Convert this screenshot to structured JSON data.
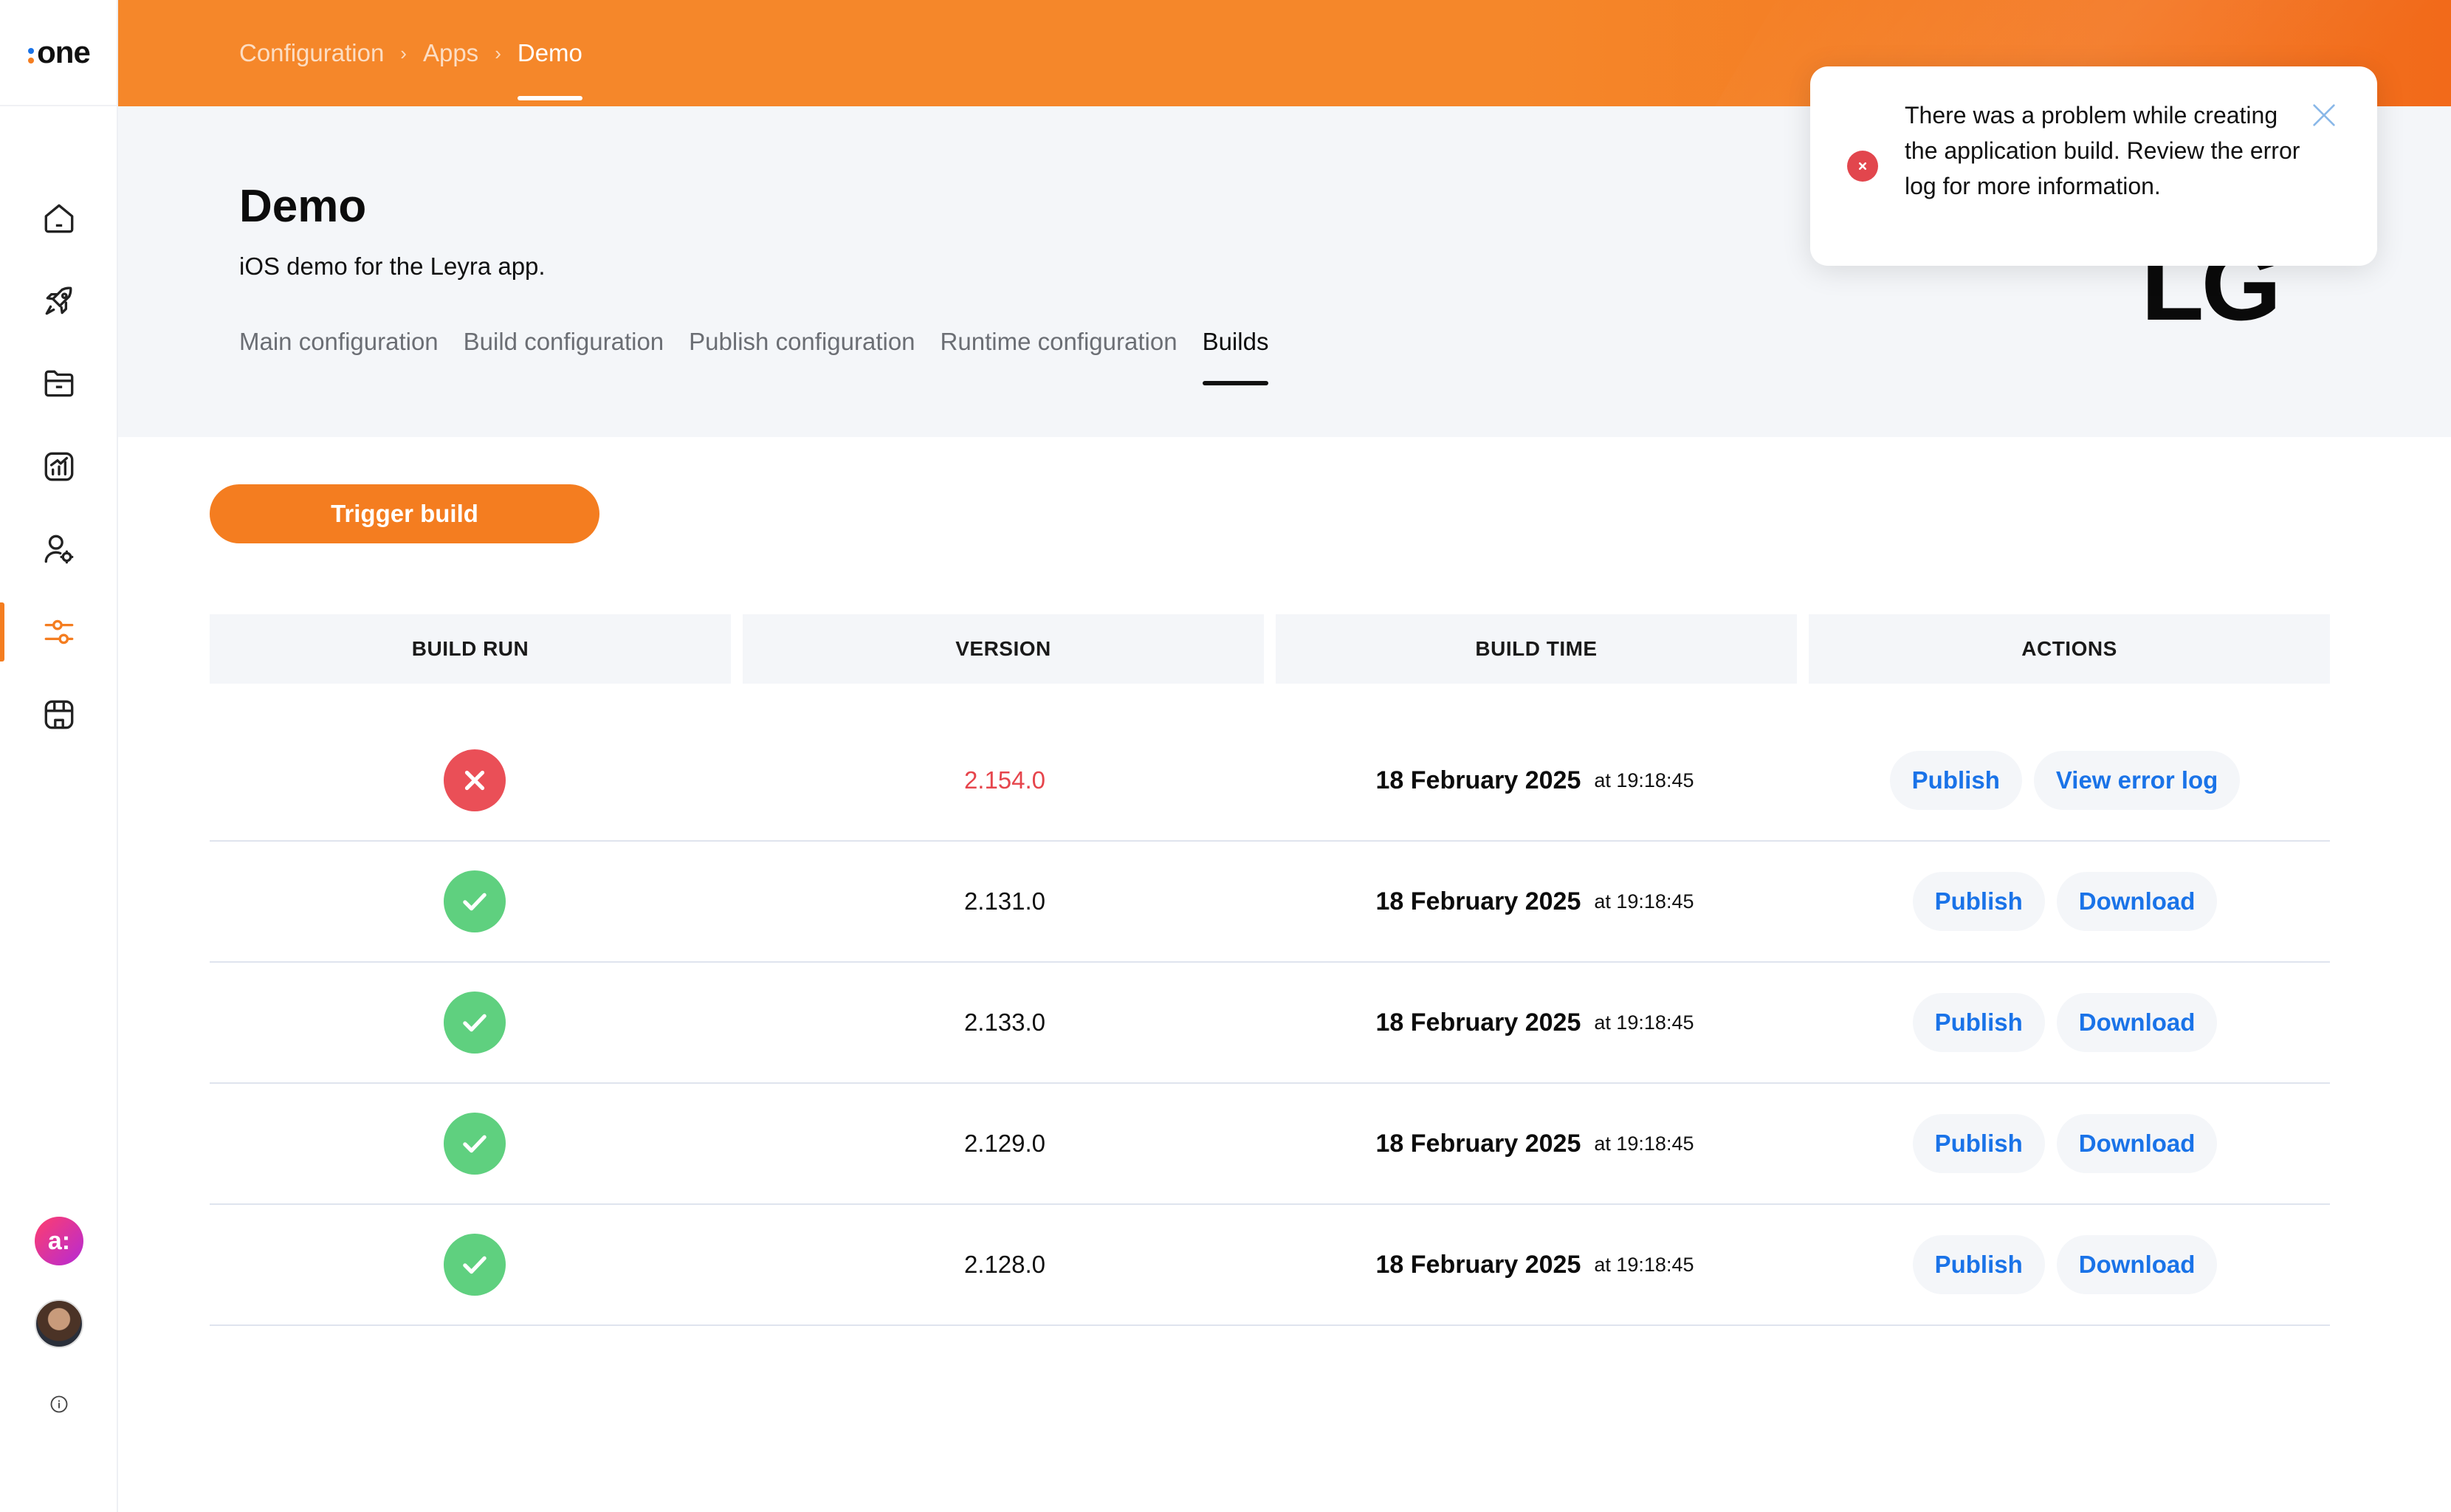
{
  "app": {
    "logo_text": "one",
    "logo_dot_colors": [
      "#1a73e8",
      "#f47d20"
    ]
  },
  "sidebar": {
    "items": [
      {
        "icon": "home-icon"
      },
      {
        "icon": "rocket-icon"
      },
      {
        "icon": "folder-icon"
      },
      {
        "icon": "analytics-icon"
      },
      {
        "icon": "user-settings-icon"
      },
      {
        "icon": "sliders-icon",
        "active": true
      },
      {
        "icon": "store-icon"
      }
    ],
    "assistant_label": "a:",
    "help_icon": "info-icon"
  },
  "breadcrumb": {
    "items": [
      "Configuration",
      "Apps",
      "Demo"
    ]
  },
  "header": {
    "title": "Demo",
    "description": "iOS demo for the Leyra app.",
    "brand_mark": "LG",
    "tabs": [
      "Main configuration",
      "Build configuration",
      "Publish configuration",
      "Runtime configuration",
      "Builds"
    ],
    "active_tab": "Builds"
  },
  "trigger_button": "Trigger build",
  "table": {
    "columns": [
      "BUILD RUN",
      "VERSION",
      "BUILD TIME",
      "ACTIONS"
    ],
    "rows": [
      {
        "status": "failed",
        "version": "2.154.0",
        "date": "18 February 2025",
        "time": "at 19:18:45",
        "actions": [
          "Publish",
          "View error log"
        ]
      },
      {
        "status": "success",
        "version": "2.131.0",
        "date": "18 February 2025",
        "time": "at 19:18:45",
        "actions": [
          "Publish",
          "Download"
        ]
      },
      {
        "status": "success",
        "version": "2.133.0",
        "date": "18 February 2025",
        "time": "at 19:18:45",
        "actions": [
          "Publish",
          "Download"
        ]
      },
      {
        "status": "success",
        "version": "2.129.0",
        "date": "18 February 2025",
        "time": "at 19:18:45",
        "actions": [
          "Publish",
          "Download"
        ]
      },
      {
        "status": "success",
        "version": "2.128.0",
        "date": "18 February 2025",
        "time": "at 19:18:45",
        "actions": [
          "Publish",
          "Download"
        ]
      }
    ]
  },
  "toast": {
    "type": "error",
    "message": "There was a problem while creating the application build. Review the error log for more information."
  },
  "colors": {
    "accent": "#f47d20",
    "link": "#1a73e8",
    "success": "#5fd07f",
    "error": "#ea4f57"
  }
}
